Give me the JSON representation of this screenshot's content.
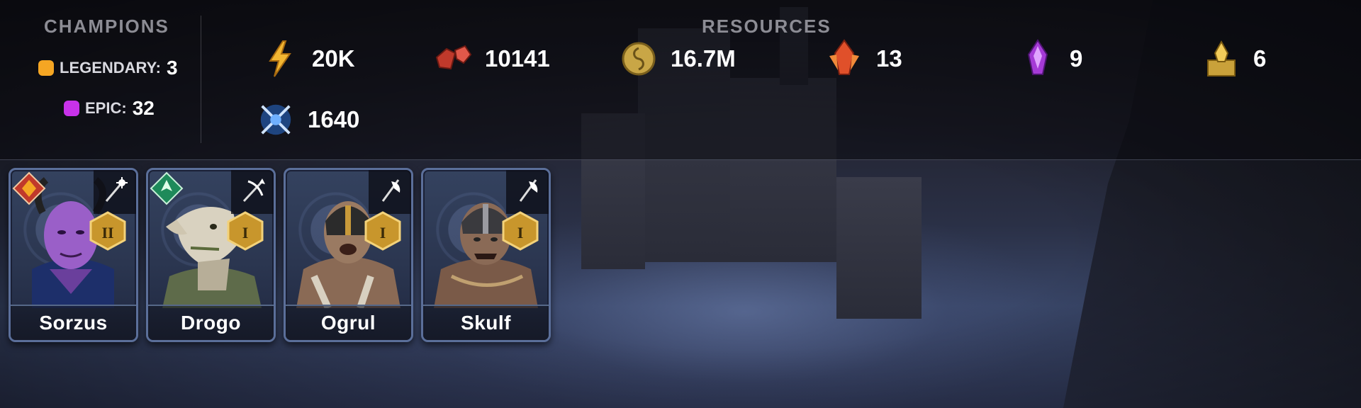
{
  "champions": {
    "title": "CHAMPIONS",
    "rarities": [
      {
        "label": "LEGENDARY:",
        "count": "3",
        "color": "#f5a623"
      },
      {
        "label": "EPIC:",
        "count": "32",
        "color": "#c832ea"
      }
    ]
  },
  "resources": {
    "title": "RESOURCES",
    "items": [
      {
        "icon": "energy-icon",
        "value": "20K"
      },
      {
        "icon": "rubies-icon",
        "value": "10141"
      },
      {
        "icon": "silver-coin-icon",
        "value": "16.7M"
      },
      {
        "icon": "ancient-shard-icon",
        "value": "13"
      },
      {
        "icon": "void-shard-icon",
        "value": "9"
      },
      {
        "icon": "sacred-shard-icon",
        "value": "6"
      },
      {
        "icon": "arena-tokens-icon",
        "value": "1640"
      }
    ]
  },
  "cards": [
    {
      "name": "Sorzus",
      "affinity": "force",
      "affinity_color": "#c0392b",
      "class_icon": "staff-icon",
      "rank": "II"
    },
    {
      "name": "Drogo",
      "affinity": "spirit",
      "affinity_color": "#1e8a5a",
      "class_icon": "crossbow-icon",
      "rank": "I"
    },
    {
      "name": "Ogrul",
      "affinity": "none",
      "affinity_color": "",
      "class_icon": "axe-icon",
      "rank": "I"
    },
    {
      "name": "Skulf",
      "affinity": "none",
      "affinity_color": "",
      "class_icon": "axe-icon",
      "rank": "I"
    }
  ],
  "colors": {
    "accent_gold": "#e6b33a",
    "card_border": "#5b6f9a"
  }
}
